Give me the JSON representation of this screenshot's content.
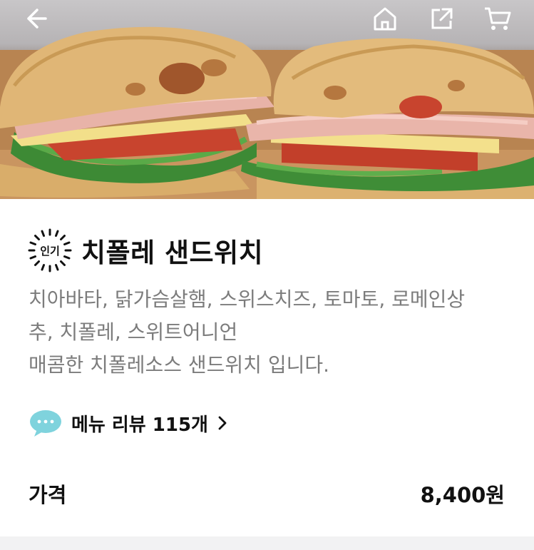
{
  "header": {
    "back_icon": "back-arrow-icon",
    "home_icon": "home-icon",
    "share_icon": "share-icon",
    "cart_icon": "cart-icon"
  },
  "product": {
    "badge_label": "인기",
    "title": "치폴레 샌드위치",
    "description_lines": [
      "치아바타, 닭가슴살햄, 스위스치즈, 토마토, 로메인상",
      "추, 치폴레, 스위트어니언",
      "매콤한 치폴레소스 샌드위치 입니다."
    ]
  },
  "review": {
    "label": "메뉴 리뷰 115개",
    "icon": "chat-bubble-icon",
    "bubble_color": "#7fd3dd"
  },
  "price": {
    "label": "가격",
    "value": "8,400원"
  }
}
